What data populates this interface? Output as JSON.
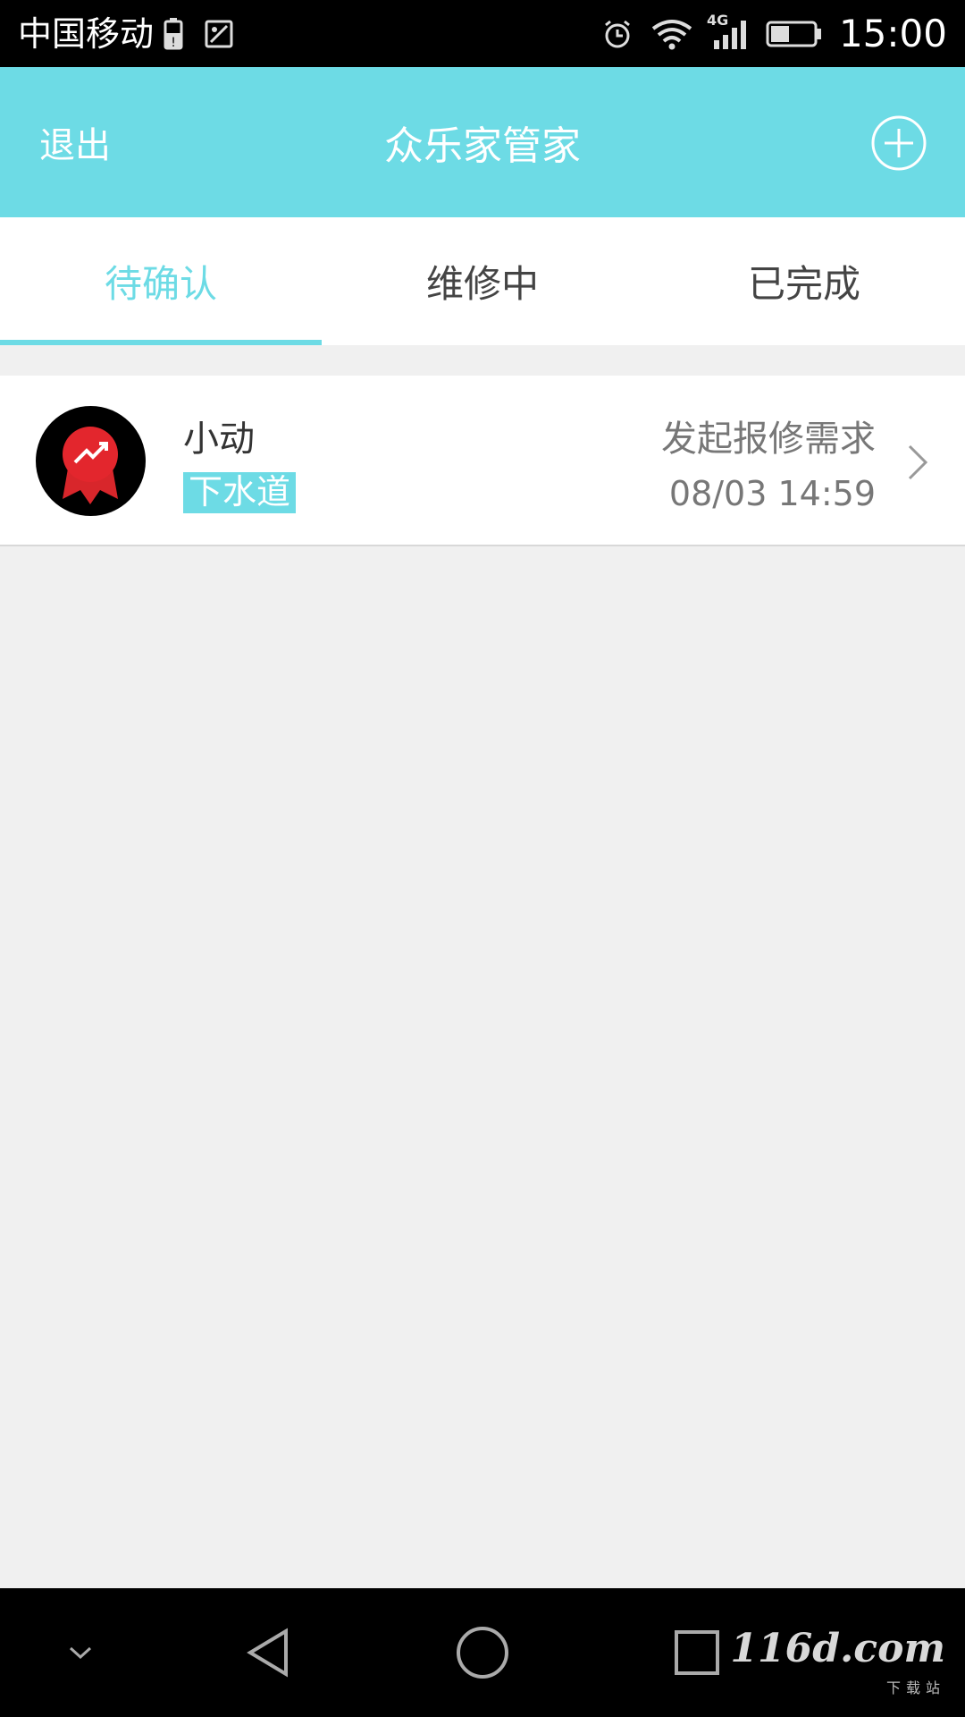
{
  "status_bar": {
    "carrier": "中国移动",
    "network": "4G",
    "time": "15:00",
    "icons": [
      "battery-alert-icon",
      "image-icon",
      "alarm-icon",
      "wifi-icon",
      "signal-icon",
      "battery-icon"
    ]
  },
  "header": {
    "exit_label": "退出",
    "title": "众乐家管家",
    "add_icon": "plus-circle-icon"
  },
  "tabs": [
    {
      "label": "待确认",
      "active": true
    },
    {
      "label": "维修中",
      "active": false
    },
    {
      "label": "已完成",
      "active": false
    }
  ],
  "orders": [
    {
      "name": "小动",
      "tag": "下水道",
      "status": "发起报修需求",
      "time": "08/03 14:59",
      "avatar_icon": "ribbon-badge-icon"
    }
  ],
  "nav": {
    "icons": [
      "collapse-icon",
      "back-icon",
      "home-icon",
      "recents-icon"
    ]
  },
  "watermark": {
    "text": "116d.com",
    "sub": "下载站"
  },
  "colors": {
    "accent": "#6ddbe5",
    "background": "#f0f0f0",
    "text_secondary": "#777777"
  }
}
